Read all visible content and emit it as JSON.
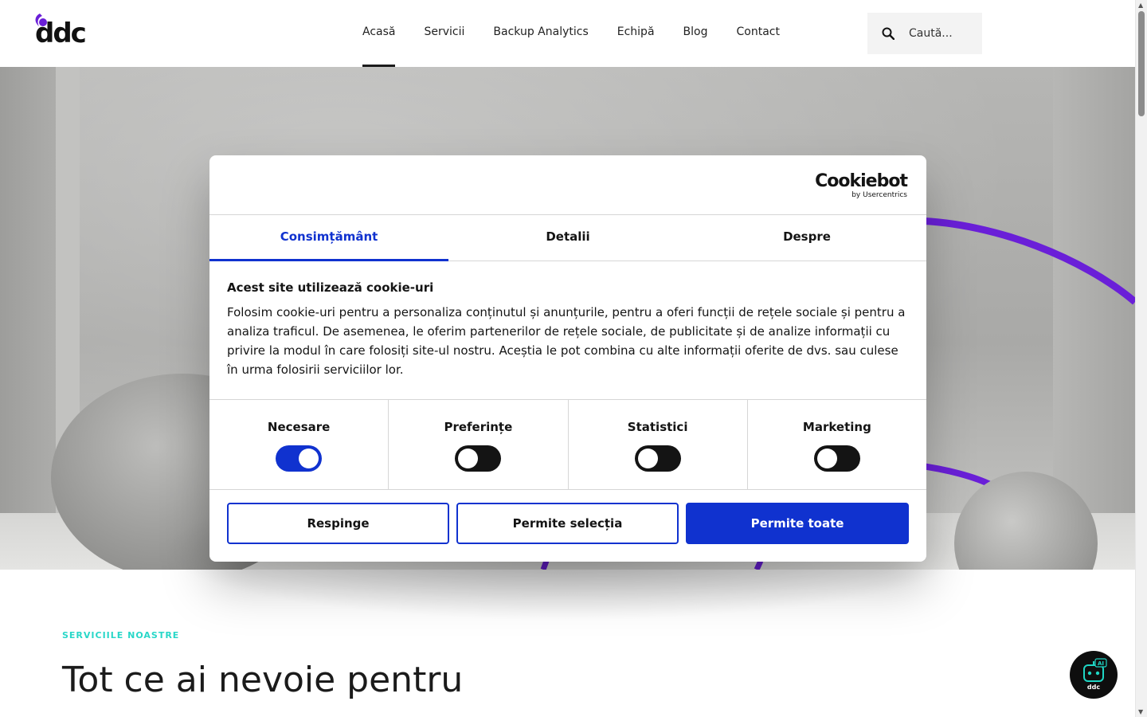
{
  "header": {
    "logo_text": "ddc",
    "nav": [
      {
        "label": "Acasă",
        "active": true
      },
      {
        "label": "Servicii",
        "active": false
      },
      {
        "label": "Backup Analytics",
        "active": false
      },
      {
        "label": "Echipă",
        "active": false
      },
      {
        "label": "Blog",
        "active": false
      },
      {
        "label": "Contact",
        "active": false
      }
    ],
    "search_placeholder": "Caută..."
  },
  "cookie_dialog": {
    "brand_name": "Cookiebot",
    "brand_sub": "by Usercentrics",
    "tabs": [
      {
        "label": "Consimțământ",
        "active": true
      },
      {
        "label": "Detalii",
        "active": false
      },
      {
        "label": "Despre",
        "active": false
      }
    ],
    "title": "Acest site utilizează cookie-uri",
    "text": "Folosim cookie-uri pentru a personaliza conținutul și anunțurile, pentru a oferi funcții de rețele sociale și pentru a analiza traficul. De asemenea, le oferim partenerilor de rețele sociale, de publicitate și de analize informații cu privire la modul în care folosiți site-ul nostru. Aceștia le pot combina cu alte informații oferite de dvs. sau culese în urma folosirii serviciilor lor.",
    "toggles": [
      {
        "label": "Necesare",
        "on": true
      },
      {
        "label": "Preferințe",
        "on": false
      },
      {
        "label": "Statistici",
        "on": false
      },
      {
        "label": "Marketing",
        "on": false
      }
    ],
    "buttons": {
      "reject": "Respinge",
      "allow_selection": "Permite selecția",
      "allow_all": "Permite toate"
    },
    "accent_color": "#1032cf"
  },
  "services": {
    "tag": "SERVICIILE NOASTRE",
    "title": "Tot ce ai nevoie pentru"
  },
  "chatbot": {
    "badge": "AI",
    "brand": "ddc"
  },
  "colors": {
    "brand_purple": "#6a1fd8",
    "tag_teal": "#28d7c8"
  }
}
